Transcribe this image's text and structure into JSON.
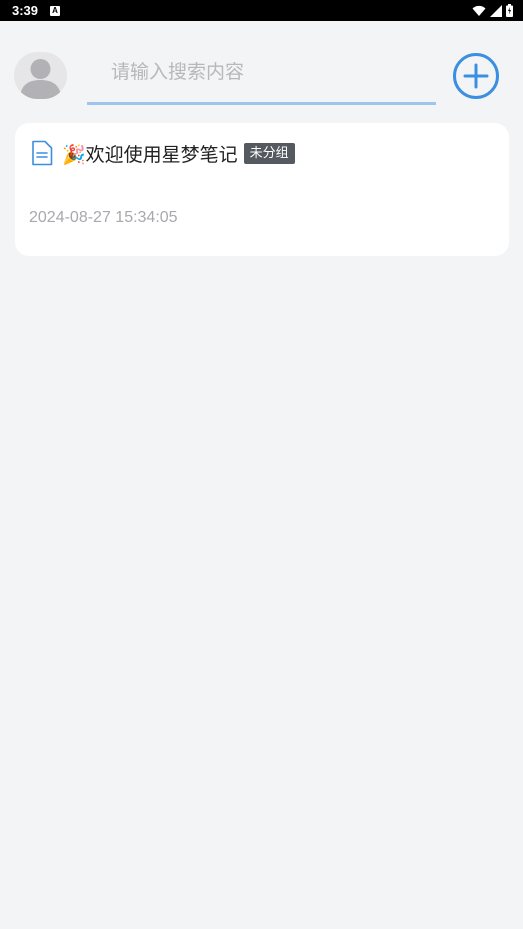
{
  "status_bar": {
    "time": "3:39",
    "notification_icon": "a-badge-icon",
    "notification_letter": "A",
    "icons": [
      "wifi-icon",
      "signal-icon",
      "battery-icon"
    ]
  },
  "header": {
    "avatar_icon": "user-avatar-icon",
    "search": {
      "value": "",
      "placeholder": "请输入搜索内容"
    },
    "add_icon": "plus-circle-icon"
  },
  "notes": [
    {
      "icon": "document-icon",
      "title": "🎉欢迎使用星梦笔记",
      "group": "未分组",
      "time": "2024-08-27 15:34:05"
    }
  ],
  "colors": {
    "accent": "#3b8fe0",
    "search_underline": "#9ec5ee",
    "badge_bg": "#555a60",
    "background": "#f3f4f6",
    "time_text": "#a8a8ad"
  }
}
